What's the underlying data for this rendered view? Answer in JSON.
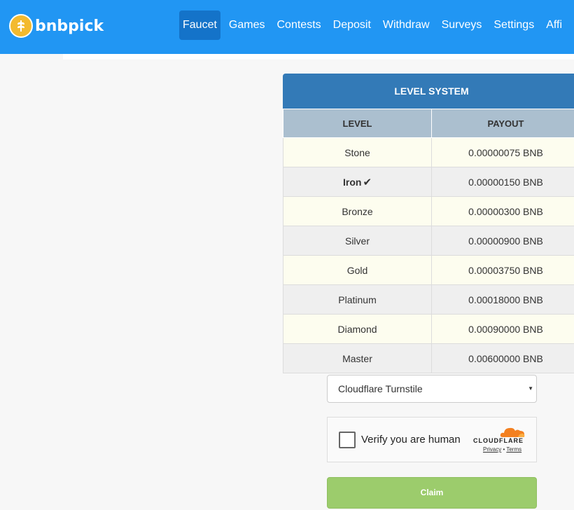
{
  "brand": {
    "name": "bnbpick",
    "logo_icon": "wheat-coin-icon",
    "logo_color": "#f3ba2f"
  },
  "nav": {
    "items": [
      {
        "label": "Faucet",
        "active": true
      },
      {
        "label": "Games"
      },
      {
        "label": "Contests"
      },
      {
        "label": "Deposit"
      },
      {
        "label": "Withdraw"
      },
      {
        "label": "Surveys"
      },
      {
        "label": "Settings"
      },
      {
        "label": "Affi"
      }
    ],
    "color": "#2196f3"
  },
  "level_system": {
    "title": "LEVEL SYSTEM",
    "headers": {
      "level": "LEVEL",
      "payout": "PAYOUT"
    },
    "rows": [
      {
        "level": "Stone",
        "payout": "0.00000075 BNB"
      },
      {
        "level": "Iron",
        "payout": "0.00000150 BNB",
        "current": true
      },
      {
        "level": "Bronze",
        "payout": "0.00000300 BNB"
      },
      {
        "level": "Silver",
        "payout": "0.00000900 BNB"
      },
      {
        "level": "Gold",
        "payout": "0.00003750 BNB"
      },
      {
        "level": "Platinum",
        "payout": "0.00018000 BNB"
      },
      {
        "level": "Diamond",
        "payout": "0.00090000 BNB"
      },
      {
        "level": "Master",
        "payout": "0.00600000 BNB"
      }
    ]
  },
  "captcha": {
    "selected": "Cloudflare Turnstile",
    "widget": {
      "label": "Verify you are human",
      "brand": "CLOUDFLARE",
      "privacy": "Privacy",
      "separator": "•",
      "terms": "Terms"
    }
  },
  "claim": {
    "label": "Claim",
    "color": "#9ccc6c"
  }
}
